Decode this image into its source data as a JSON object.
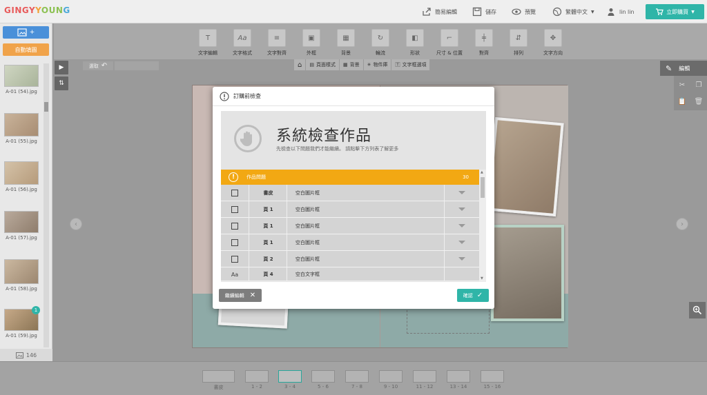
{
  "header": {
    "logo": [
      "GINGY",
      "Y",
      "OUN",
      "G"
    ],
    "quick_edit": "簡易編輯",
    "save": "儲存",
    "preview": "預覽",
    "language": "繁體中文",
    "user": "lin lin",
    "buy_now": "立即購買"
  },
  "sidebar": {
    "add_photos": "+",
    "auto_fill": "自動填圖",
    "photos": [
      {
        "name": "A-01 (54).jpg",
        "badge": ""
      },
      {
        "name": "A-01 (55).jpg",
        "badge": ""
      },
      {
        "name": "A-01 (56).jpg",
        "badge": ""
      },
      {
        "name": "A-01 (57).jpg",
        "badge": ""
      },
      {
        "name": "A-01 (58).jpg",
        "badge": ""
      },
      {
        "name": "A-01 (59).jpg",
        "badge": "1"
      }
    ],
    "photo_count": "146"
  },
  "toolbar": {
    "tools": [
      "文字編輯",
      "文字格式",
      "文字對齊",
      "外框",
      "背景",
      "輪流",
      "形狀",
      "尺寸 & 位置",
      "對齊",
      "排列",
      "文字方向"
    ]
  },
  "subnav": {
    "items": [
      "頁面樣式",
      "背景",
      "物件庫",
      "文字框選項"
    ]
  },
  "undo_label": "選取",
  "right_panel": {
    "edit_label": "編輯"
  },
  "dialog": {
    "title": "訂購前檢查",
    "heading": "系統檢查作品",
    "subtitle": "先檢查以下問題我們才能繼續。 請點擊下方列表了解更多",
    "issues_label": "作品問題",
    "issues_count": "30",
    "rows": [
      {
        "icon": "checkbox",
        "page": "書皮",
        "issue": "空白圖片框"
      },
      {
        "icon": "checkbox",
        "page": "頁 1",
        "issue": "空白圖片框"
      },
      {
        "icon": "checkbox",
        "page": "頁 1",
        "issue": "空白圖片框"
      },
      {
        "icon": "checkbox",
        "page": "頁 1",
        "issue": "空白圖片框"
      },
      {
        "icon": "checkbox",
        "page": "頁 2",
        "issue": "空白圖片框"
      },
      {
        "icon": "text",
        "icon_text": "Aa",
        "page": "頁 4",
        "issue": "空白文字框"
      }
    ],
    "continue_label": "繼續編輯",
    "confirm_label": "確認"
  },
  "pages": [
    {
      "label": "書皮",
      "selected": false
    },
    {
      "label": "1 - 2",
      "selected": false
    },
    {
      "label": "3 - 4",
      "selected": true
    },
    {
      "label": "5 - 6",
      "selected": false
    },
    {
      "label": "7 - 8",
      "selected": false
    },
    {
      "label": "9 - 10",
      "selected": false
    },
    {
      "label": "11 - 12",
      "selected": false
    },
    {
      "label": "13 - 14",
      "selected": false
    },
    {
      "label": "15 - 16",
      "selected": false
    }
  ],
  "colors": {
    "accent": "#2fb5a8",
    "warning": "#f2a813",
    "add_button": "#4a90d9",
    "auto_fill": "#f0a34a"
  }
}
